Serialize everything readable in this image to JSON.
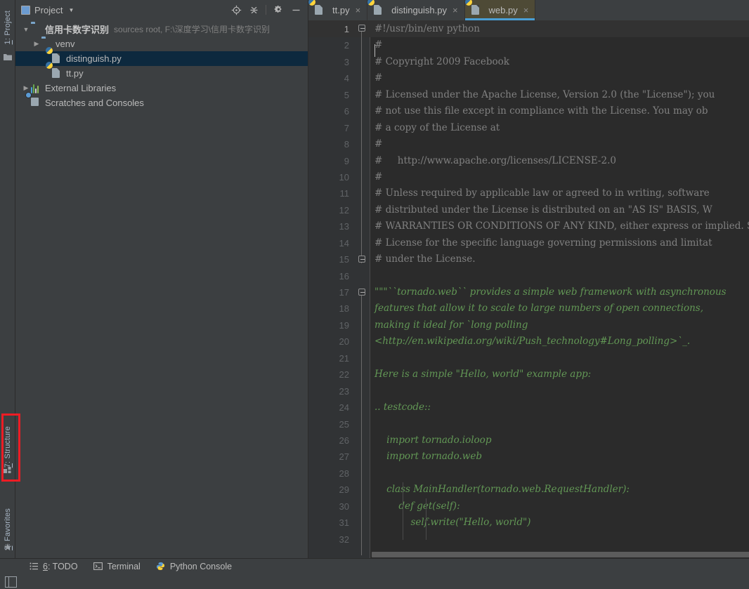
{
  "left_stripe": {
    "tabs": [
      {
        "name": "project",
        "prefix": "1",
        "label": ": Project"
      },
      {
        "name": "structure",
        "prefix": "7",
        "label": ": Structure"
      },
      {
        "name": "favorites",
        "prefix": "2",
        "label": ": Favorites"
      }
    ],
    "highlight_color": "#ed1c24",
    "highlighted_tab": "7: Structure"
  },
  "project_panel": {
    "title": "Project",
    "dropdown_arrow": "▼",
    "toolbar": [
      {
        "name": "locate-icon",
        "tooltip": "Select Opened File"
      },
      {
        "name": "collapse-all-icon",
        "tooltip": "Collapse All"
      },
      {
        "name": "gear-icon",
        "tooltip": "Settings"
      },
      {
        "name": "minimize-icon",
        "tooltip": "Hide"
      }
    ],
    "tree": [
      {
        "twisty": "▼",
        "icon": "folder-icon",
        "label": "信用卡数字识别",
        "bold": true,
        "sub": "sources root, F:\\深度学习\\信用卡数字识别",
        "indent": 0,
        "selected": false
      },
      {
        "twisty": "▶",
        "icon": "folder-icon",
        "label": "venv",
        "bold": false,
        "sub": "",
        "indent": 1,
        "selected": false
      },
      {
        "twisty": "",
        "icon": "python-file-icon",
        "label": "distinguish.py",
        "bold": false,
        "sub": "",
        "indent": 2,
        "selected": true
      },
      {
        "twisty": "",
        "icon": "python-file-icon",
        "label": "tt.py",
        "bold": false,
        "sub": "",
        "indent": 2,
        "selected": false
      },
      {
        "twisty": "▶",
        "icon": "external-libraries-icon",
        "label": "External Libraries",
        "bold": false,
        "sub": "",
        "indent": 0,
        "selected": false
      },
      {
        "twisty": "",
        "icon": "scratches-icon",
        "label": "Scratches and Consoles",
        "bold": false,
        "sub": "",
        "indent": 0,
        "selected": false
      }
    ]
  },
  "editor": {
    "tabs": [
      {
        "label": "tt.py",
        "active": false,
        "close": "×"
      },
      {
        "label": "distinguish.py",
        "active": false,
        "close": "×"
      },
      {
        "label": "web.py",
        "active": true,
        "close": "×"
      }
    ],
    "active_tab_accent": "#4a9fd5",
    "current_line": 1,
    "lines": [
      {
        "n": "1",
        "text": "#!/usr/bin/env python",
        "style": "comment"
      },
      {
        "n": "2",
        "text": "#",
        "style": "comment"
      },
      {
        "n": "3",
        "text": "# Copyright 2009 Facebook",
        "style": "comment"
      },
      {
        "n": "4",
        "text": "#",
        "style": "comment"
      },
      {
        "n": "5",
        "text": "# Licensed under the Apache License, Version 2.0 (the \"License\"); you",
        "style": "comment"
      },
      {
        "n": "6",
        "text": "# not use this file except in compliance with the License. You may ob",
        "style": "comment"
      },
      {
        "n": "7",
        "text": "# a copy of the License at",
        "style": "comment"
      },
      {
        "n": "8",
        "text": "#",
        "style": "comment"
      },
      {
        "n": "9",
        "text": "#     http://www.apache.org/licenses/LICENSE-2.0",
        "style": "comment"
      },
      {
        "n": "10",
        "text": "#",
        "style": "comment"
      },
      {
        "n": "11",
        "text": "# Unless required by applicable law or agreed to in writing, software",
        "style": "comment"
      },
      {
        "n": "12",
        "text": "# distributed under the License is distributed on an \"AS IS\" BASIS, W",
        "style": "comment"
      },
      {
        "n": "13",
        "text": "# WARRANTIES OR CONDITIONS OF ANY KIND, either express or implied. Se",
        "style": "comment"
      },
      {
        "n": "14",
        "text": "# License for the specific language governing permissions and limitat",
        "style": "comment"
      },
      {
        "n": "15",
        "text": "# under the License.",
        "style": "comment"
      },
      {
        "n": "16",
        "text": "",
        "style": "comment"
      },
      {
        "n": "17",
        "text": "\"\"\"``tornado.web`` provides a simple web framework with asynchronous",
        "style": "doc"
      },
      {
        "n": "18",
        "text": "features that allow it to scale to large numbers of open connections,",
        "style": "doc"
      },
      {
        "n": "19",
        "text": "making it ideal for `long polling",
        "style": "doc"
      },
      {
        "n": "20",
        "text": "<http://en.wikipedia.org/wiki/Push_technology#Long_polling>`_.",
        "style": "doc"
      },
      {
        "n": "21",
        "text": "",
        "style": "doc"
      },
      {
        "n": "22",
        "text": "Here is a simple \"Hello, world\" example app:",
        "style": "doc"
      },
      {
        "n": "23",
        "text": "",
        "style": "doc"
      },
      {
        "n": "24",
        "text": ".. testcode::",
        "style": "doc"
      },
      {
        "n": "25",
        "text": "",
        "style": "doc"
      },
      {
        "n": "26",
        "text": "    import tornado.ioloop",
        "style": "doc"
      },
      {
        "n": "27",
        "text": "    import tornado.web",
        "style": "doc"
      },
      {
        "n": "28",
        "text": "",
        "style": "doc"
      },
      {
        "n": "29",
        "text": "    class MainHandler(tornado.web.RequestHandler):",
        "style": "doc"
      },
      {
        "n": "30",
        "text": "        def get(self):",
        "style": "doc"
      },
      {
        "n": "31",
        "text": "            self.write(\"Hello, world\")",
        "style": "doc"
      },
      {
        "n": "32",
        "text": "",
        "style": "doc"
      }
    ]
  },
  "bottom_bar": {
    "buttons": [
      {
        "name": "todo",
        "icon": "list-icon",
        "prefix": "6",
        "label": ": TODO"
      },
      {
        "name": "terminal",
        "icon": "terminal-icon",
        "prefix": "",
        "label": "Terminal"
      },
      {
        "name": "python-console",
        "icon": "python-icon",
        "prefix": "",
        "label": "Python Console"
      }
    ]
  }
}
